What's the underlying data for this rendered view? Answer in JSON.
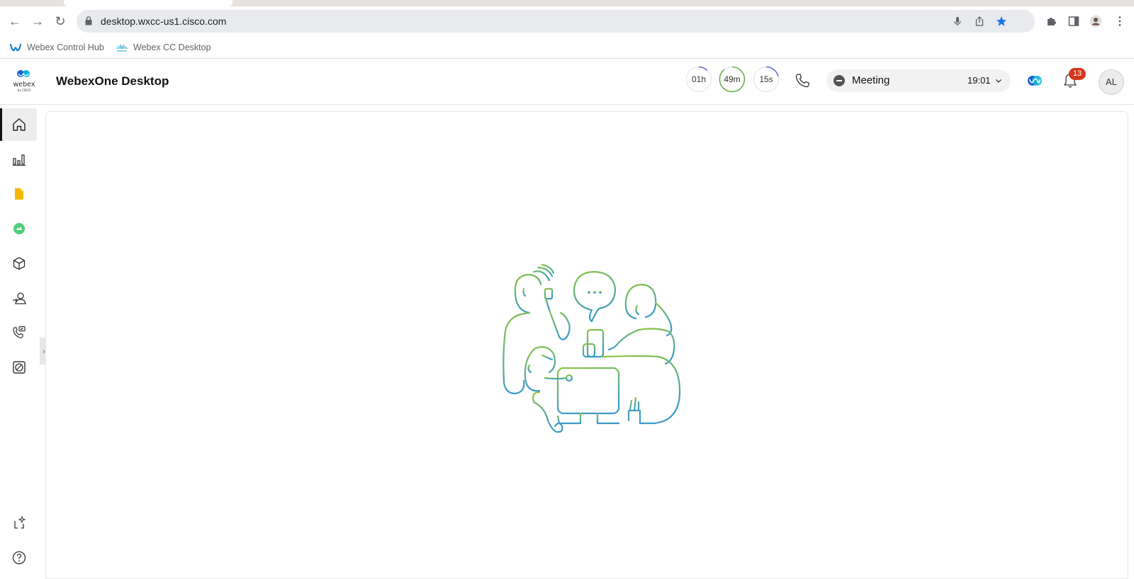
{
  "browser": {
    "url": "desktop.wxcc-us1.cisco.com",
    "bookmarks": [
      {
        "label": "Webex Control Hub",
        "icon": "webex-icon"
      },
      {
        "label": "Webex CC Desktop",
        "icon": "cisco-icon"
      }
    ]
  },
  "header": {
    "title": "WebexOne Desktop",
    "logo_text": "webex",
    "logo_sub": "by CISCO",
    "timers": {
      "hours": "01h",
      "minutes": "49m",
      "seconds": "15s"
    },
    "state": {
      "label": "Meeting",
      "elapsed": "19:01",
      "color": "#545454"
    },
    "notifications_count": "13",
    "avatar_initials": "AL"
  },
  "sidebar": {
    "items": [
      {
        "name": "home",
        "icon": "home-icon",
        "active": true
      },
      {
        "name": "analytics",
        "icon": "bar-chart-icon"
      },
      {
        "name": "documents",
        "icon": "document-icon"
      },
      {
        "name": "green-app",
        "icon": "green-circle-icon"
      },
      {
        "name": "package",
        "icon": "cube-icon"
      },
      {
        "name": "contacts",
        "icon": "user-transfer-icon"
      },
      {
        "name": "call-notes",
        "icon": "phone-card-icon"
      },
      {
        "name": "widget",
        "icon": "square-circle-icon"
      }
    ],
    "footer": [
      {
        "name": "feedback",
        "icon": "sparkle-bracket-icon"
      },
      {
        "name": "help",
        "icon": "help-icon"
      }
    ]
  },
  "colors": {
    "accent": "#d4371c",
    "illustration_start": "#7cc35a",
    "illustration_end": "#3a9bc8"
  }
}
